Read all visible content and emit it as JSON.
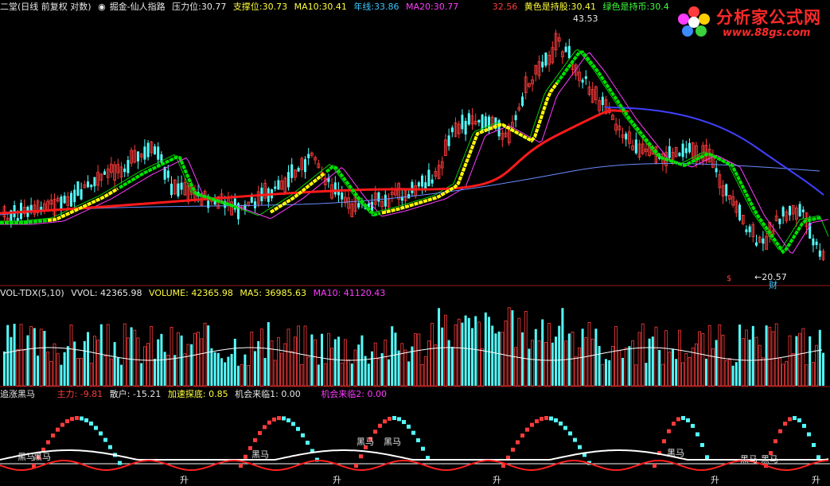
{
  "main_header": {
    "title": "二堂(日线 前复权 对数)",
    "indicator_name": "掘金-仙人指路",
    "pressure_label": "压力位:",
    "pressure_value": "30.77",
    "support_label": "支撑位:",
    "support_value": "30.73",
    "ma10_label": "MA10:",
    "ma10_value": "30.41",
    "year_label": "年线:",
    "year_value": "33.86",
    "ma20_label": "MA20:",
    "ma20_value": "30.77",
    "red_value": "32.56",
    "yellow_label": "黄色是持股:",
    "yellow_value": "30.41",
    "green_label": "绿色是持币:",
    "green_value": "30.4"
  },
  "main_chart": {
    "high_label": "43.53",
    "low_label": "←20.57",
    "low_tag": "财",
    "signal_mark": "$"
  },
  "vol_header": {
    "name": "VOL-TDX(5,10)",
    "vvol_label": "VVOL:",
    "vvol_value": "42365.98",
    "volume_label": "VOLUME:",
    "volume_value": "42365.98",
    "ma5_label": "MA5:",
    "ma5_value": "36985.63",
    "ma10_label": "MA10:",
    "ma10_value": "41120.43"
  },
  "ind_header": {
    "name": "追涨黑马",
    "main_label": "主力:",
    "main_value": "-9.81",
    "retail_label": "散户:",
    "retail_value": "-15.21",
    "accel_label": "加速探底:",
    "accel_value": "0.85",
    "chance1_label": "机会来临1:",
    "chance1_value": "0.00",
    "chance2_label": "机会来临2:",
    "chance2_value": "0.00"
  },
  "signals": {
    "heima": "黑马",
    "sheng": "升"
  },
  "logo": {
    "name": "分析家公式网",
    "url": "www.88gs.com"
  },
  "colors": {
    "up": "#ff3c3c",
    "down": "#54fcfc",
    "yellow": "#ffff00",
    "green": "#00e000",
    "magenta": "#ff3cff",
    "blue": "#3c3cff"
  }
}
